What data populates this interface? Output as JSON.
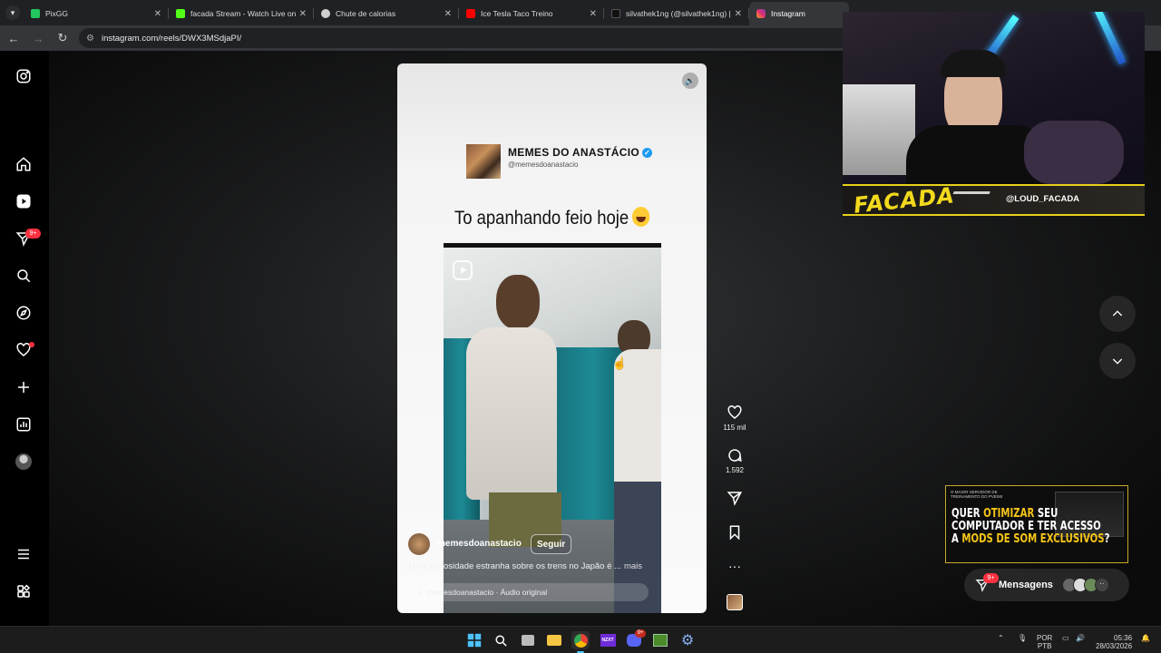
{
  "browser": {
    "tabs": [
      {
        "title": "PixGG",
        "icon": "pixgg-icon",
        "color": "#22c55e",
        "active": false
      },
      {
        "title": "facada Stream - Watch Live on ",
        "icon": "kick-icon",
        "color": "#53fc18",
        "active": false
      },
      {
        "title": "Chute de calorias",
        "icon": "chatgpt-icon",
        "color": "#cfcfcf",
        "active": false
      },
      {
        "title": "Ice Tesla Taco Treino",
        "icon": "youtube-icon",
        "color": "#ff0000",
        "active": false
      },
      {
        "title": "silvathek1ng (@silvathek1ng) |",
        "icon": "tiktok-icon",
        "color": "#111111",
        "active": false
      },
      {
        "title": "Instagram",
        "icon": "instagram-icon",
        "color": "#e1306c",
        "active": true
      }
    ],
    "url": "instagram.com/reels/DWX3MSdjaPI/"
  },
  "sidebar": {
    "messages_badge": "9+"
  },
  "reel": {
    "channel_name": "MEMES DO ANASTÁCIO",
    "channel_handle": "@memesdoanastacio",
    "caption": "To apanhando feio hoje",
    "owner": "memesdoanastacio",
    "follow_label": "Seguir",
    "description": "Uma curiosidade estranha sobre os trens no Japão é ...",
    "more_label": "mais",
    "audio": "memesdoanastacio · Áudio original",
    "likes": "115 mil",
    "comments": "1.592"
  },
  "webcam": {
    "brand": "FACADA",
    "handle": "@LOUD_FACADA"
  },
  "ad": {
    "small_text": "O MAIOR SERVIDOR DE TREINAMENTO DO PVE/MI",
    "line1_a": "QUER ",
    "line1_b": "OTIMIZAR",
    "line1_c": " SEU",
    "line2": "COMPUTADOR E TER ACESSO",
    "line3_a": "A ",
    "line3_b": "MODS DE SOM EXCLUSIVOS",
    "line3_c": "?"
  },
  "messages": {
    "label": "Mensagens",
    "badge": "9+"
  },
  "taskbar": {
    "lang_1": "POR",
    "lang_2": "PTB",
    "time": "05:36",
    "date": "28/03/2026",
    "discord_badge": "9+"
  },
  "colors": {
    "accent_red": "#ff3040",
    "brand_yellow": "#f2d91c"
  }
}
